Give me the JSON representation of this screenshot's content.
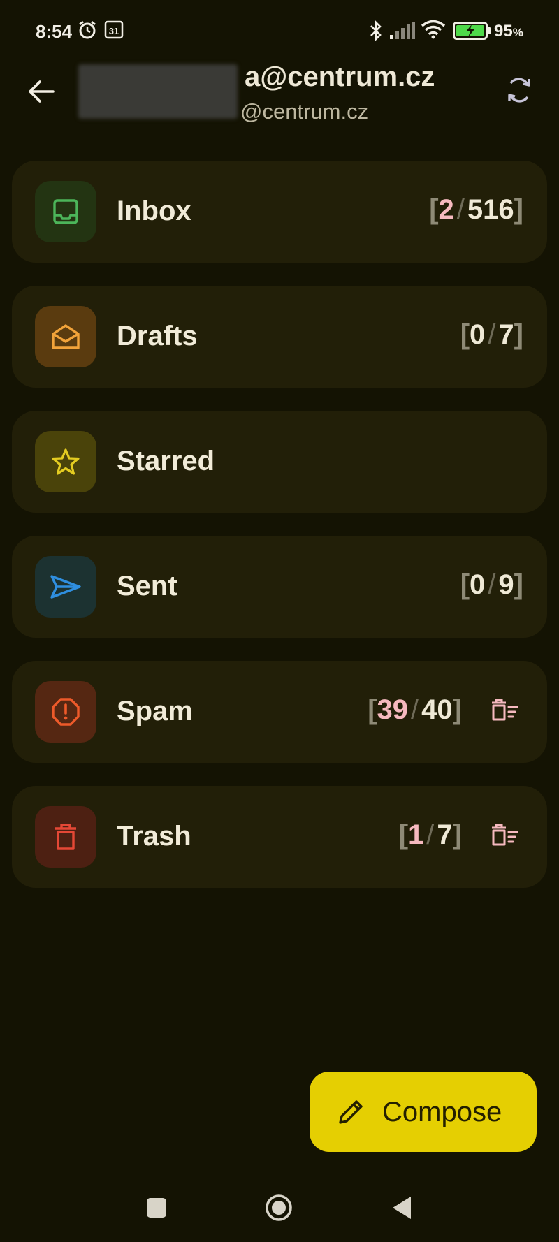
{
  "status_bar": {
    "time": "8:54",
    "calendar_day": "31",
    "battery_percent": "95",
    "battery_unit": "%"
  },
  "header": {
    "account_primary": "a@centrum.cz",
    "account_secondary": "@centrum.cz"
  },
  "folders": [
    {
      "name": "Inbox",
      "new": "2",
      "total": "516",
      "icon": "inbox-icon",
      "color": "#4cb55a",
      "new_color": "#f6b9bf",
      "has_empty": false
    },
    {
      "name": "Drafts",
      "new": "0",
      "total": "7",
      "icon": "envelope-open-icon",
      "color": "#f2a33a",
      "new_color": "#efe9d6",
      "has_empty": false
    },
    {
      "name": "Starred",
      "icon": "star-icon",
      "color": "#e4cc21",
      "has_empty": false
    },
    {
      "name": "Sent",
      "new": "0",
      "total": "9",
      "icon": "send-icon",
      "color": "#2f8fe0",
      "new_color": "#efe9d6",
      "has_empty": false
    },
    {
      "name": "Spam",
      "new": "39",
      "total": "40",
      "icon": "spam-icon",
      "color": "#ee5a2a",
      "new_color": "#f6b9bf",
      "has_empty": true
    },
    {
      "name": "Trash",
      "new": "1",
      "total": "7",
      "icon": "trash-icon",
      "color": "#e54836",
      "new_color": "#f6b9bf",
      "has_empty": true
    }
  ],
  "compose": {
    "label": "Compose",
    "icon": "pencil-icon"
  },
  "nav_bar": {
    "icons": [
      "square-recents-icon",
      "circle-home-icon",
      "triangle-back-icon"
    ]
  }
}
